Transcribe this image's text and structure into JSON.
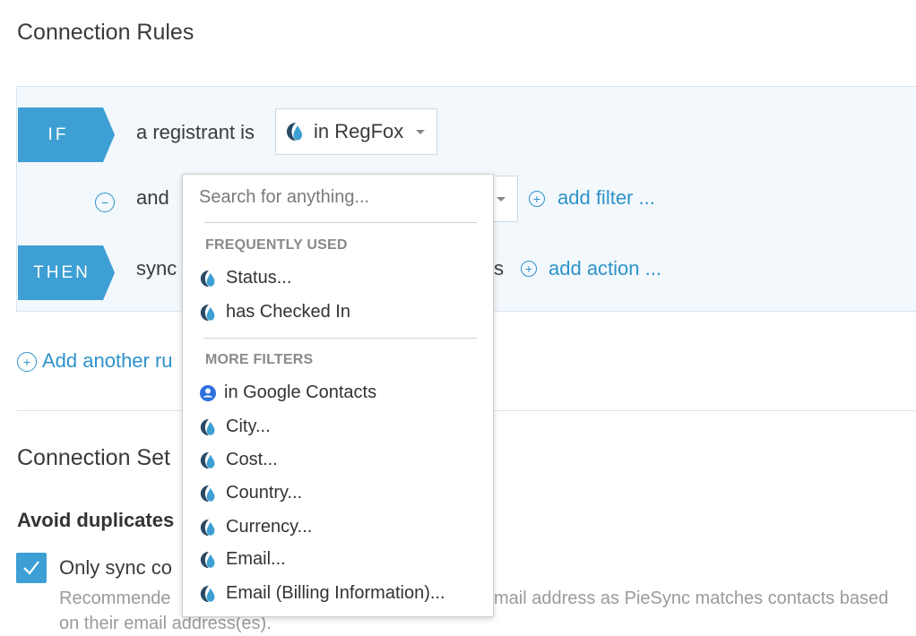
{
  "header": {
    "title": "Connection Rules"
  },
  "rule": {
    "if_tag": "IF",
    "then_tag": "THEN",
    "condition_text": "a registrant is",
    "source_select": {
      "value": "in RegFox",
      "icon": "regfox-icon"
    },
    "filter_join": "and",
    "add_filter_label": "add filter ...",
    "action_prefix": "sync",
    "action_suffix": "s",
    "add_action_label": "add action ..."
  },
  "add_rule_label": "Add another ru",
  "settings": {
    "title": "Connection Set",
    "avoid_duplicates_title": "Avoid duplicates",
    "only_sync_label": "Only sync co",
    "recommendation_line1_left": "Recommende",
    "recommendation_line1_right": "mail address as PieSync matches contacts based",
    "recommendation_line2": "on their email address(es)."
  },
  "dropdown": {
    "search_placeholder": "Search for anything...",
    "frequently_used_title": "FREQUENTLY USED",
    "frequently_used": [
      {
        "label": "Status...",
        "icon": "regfox-icon"
      },
      {
        "label": "has Checked In",
        "icon": "regfox-icon"
      }
    ],
    "more_filters_title": "MORE FILTERS",
    "more_filters": [
      {
        "label": "in Google Contacts",
        "icon": "google-contacts-icon"
      },
      {
        "label": "City...",
        "icon": "regfox-icon"
      },
      {
        "label": "Cost...",
        "icon": "regfox-icon"
      },
      {
        "label": "Country...",
        "icon": "regfox-icon"
      },
      {
        "label": "Currency...",
        "icon": "regfox-icon"
      },
      {
        "label": "Email...",
        "icon": "regfox-icon"
      },
      {
        "label": "Email (Billing Information)...",
        "icon": "regfox-icon"
      }
    ]
  },
  "colors": {
    "accent": "#3d9fd4",
    "link": "#2e93c9"
  }
}
